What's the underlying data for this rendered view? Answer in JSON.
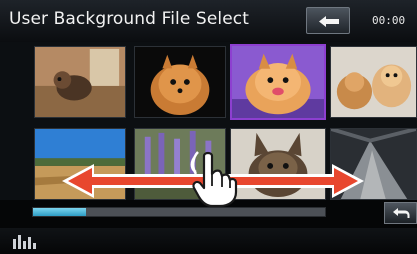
{
  "header": {
    "title": "User Background File Select",
    "time": "00:00"
  },
  "icons": {
    "back": "back-arrow-icon",
    "return": "return-icon",
    "equalizer": "equalizer-icon",
    "swipe": "swipe-arrows-icon",
    "hand": "pointing-hand-icon"
  },
  "thumbnails": [
    {
      "subject": "dog on floor"
    },
    {
      "subject": "pomeranian puppy"
    },
    {
      "subject": "pomeranian puppy",
      "selected": true
    },
    {
      "subject": "puppies"
    },
    {
      "subject": "field landscape"
    },
    {
      "subject": "lavender"
    },
    {
      "subject": "french bulldog"
    },
    {
      "subject": "tunnel path"
    }
  ],
  "progress": {
    "value": 0.18
  },
  "colors": {
    "selected_border": "#8d3fd0",
    "progress_fill": "#3ab2da",
    "swipe_arrow": "#e8472e"
  }
}
